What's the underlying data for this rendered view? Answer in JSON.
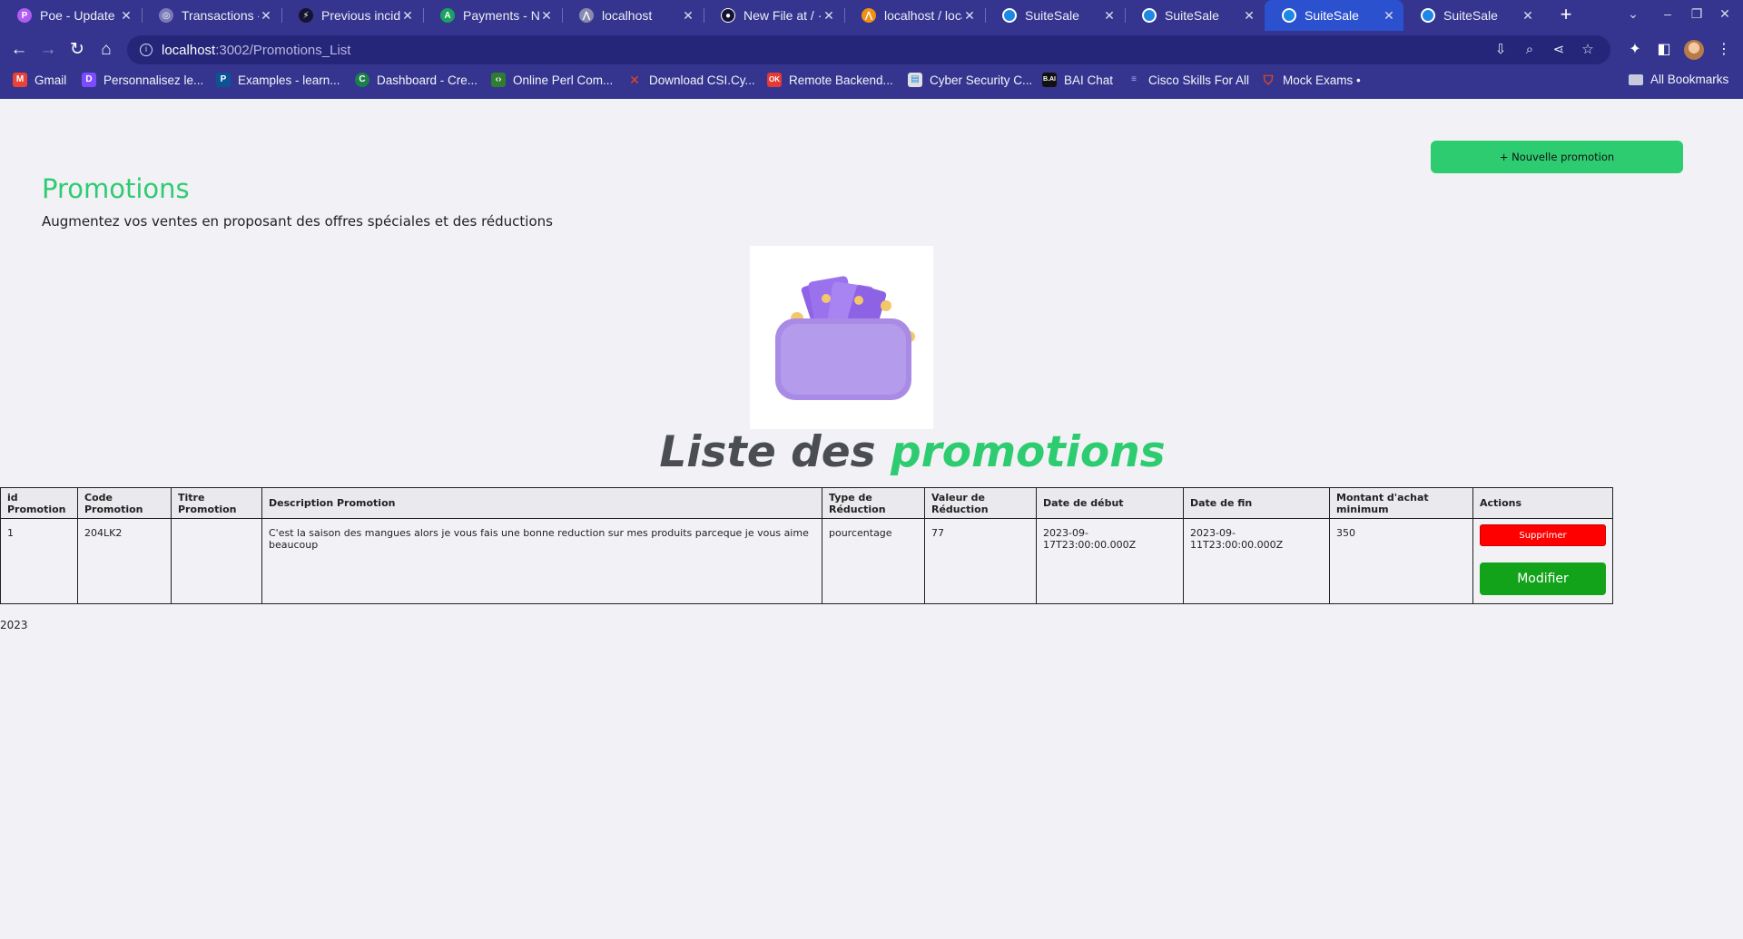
{
  "browser": {
    "tabs": [
      {
        "title": "Poe - Update C",
        "icon": "poe-icon",
        "color": "#b05cf0",
        "glyph": "P"
      },
      {
        "title": "Transactions -",
        "icon": "globe-icon",
        "color": "#7a7ab8",
        "glyph": "◎"
      },
      {
        "title": "Previous incide",
        "icon": "bolt-icon",
        "color": "#141432",
        "glyph": "⚡"
      },
      {
        "title": "Payments - No",
        "icon": "payments-icon",
        "color": "#1aa260",
        "glyph": "A"
      },
      {
        "title": "localhost",
        "icon": "xampp-icon",
        "color": "#8a8ab0",
        "glyph": "⋀"
      },
      {
        "title": "New File at / · S",
        "icon": "github-icon",
        "color": "#141432",
        "glyph": "●"
      },
      {
        "title": "localhost / loca",
        "icon": "phpmyadmin-icon",
        "color": "#f29111",
        "glyph": "⋀"
      },
      {
        "title": "SuiteSale",
        "icon": "suitesale-icon",
        "color": "#1e88e5",
        "glyph": "●"
      },
      {
        "title": "SuiteSale",
        "icon": "suitesale-icon",
        "color": "#1e88e5",
        "glyph": "●"
      },
      {
        "title": "SuiteSale",
        "icon": "suitesale-icon",
        "color": "#1e88e5",
        "glyph": "●",
        "active": true
      },
      {
        "title": "SuiteSale",
        "icon": "suitesale-icon",
        "color": "#1e88e5",
        "glyph": "●"
      }
    ],
    "url_host": "localhost",
    "url_path": ":3002/Promotions_List",
    "bookmarks": [
      {
        "label": "Gmail",
        "icon": "gmail-icon",
        "color": "#ea4335",
        "glyph": "M"
      },
      {
        "label": "Personnalisez le...",
        "icon": "bookmark-d-icon",
        "color": "#7b4dff",
        "glyph": "D"
      },
      {
        "label": "Examples - learn...",
        "icon": "bookmark-p-icon",
        "color": "#0b5394",
        "glyph": "P"
      },
      {
        "label": "Dashboard - Cre...",
        "icon": "bookmark-c-icon",
        "color": "#1b7f4b",
        "glyph": "C"
      },
      {
        "label": "Online Perl Com...",
        "icon": "code-icon",
        "color": "#2e7d32",
        "glyph": "‹›"
      },
      {
        "label": "Download CSI.Cy...",
        "icon": "bookmark-x-icon",
        "color": "#e64a19",
        "glyph": "✕"
      },
      {
        "label": "Remote Backend...",
        "icon": "bookmark-ok-icon",
        "color": "#e53935",
        "glyph": "OK"
      },
      {
        "label": "Cyber Security C...",
        "icon": "bookmark-doc-icon",
        "color": "#e0e0e0",
        "glyph": "▤"
      },
      {
        "label": "BAI Chat",
        "icon": "bai-chat-icon",
        "color": "#111111",
        "glyph": "B"
      },
      {
        "label": "Cisco Skills For All",
        "icon": "cisco-icon",
        "color": "#5e6a9e",
        "glyph": "≡"
      },
      {
        "label": "Mock Exams •",
        "icon": "shield-icon",
        "color": "#e64a19",
        "glyph": "◆"
      }
    ],
    "all_bookmarks": "All Bookmarks"
  },
  "header": {
    "new_button": "+ Nouvelle promotion",
    "title": "Promotions",
    "subtitle": "Augmentez vos ventes en proposant des offres spéciales et des réductions"
  },
  "list": {
    "title_part1": "Liste des ",
    "title_part2": "promotions",
    "columns": [
      "id Promotion",
      "Code Promotion",
      "Titre Promotion",
      "Description Promotion",
      "Type de Réduction",
      "Valeur de Réduction",
      "Date de début",
      "Date de fin",
      "Montant d'achat minimum",
      "Actions"
    ],
    "rows": [
      {
        "id": "1",
        "code": "204LK2",
        "titre": "",
        "description": "C'est la saison des mangues alors je vous fais une bonne reduction sur mes produits parceque je vous aime beaucoup",
        "type": "pourcentage",
        "valeur": "77",
        "date_debut": "2023-09-17T23:00:00.000Z",
        "date_fin": "2023-09-11T23:00:00.000Z",
        "montant_min": "350",
        "delete_label": "Supprimer",
        "edit_label": "Modifier"
      }
    ]
  },
  "footer": {
    "year": "2023"
  },
  "colors": {
    "accent_green": "#2ecc71",
    "delete_red": "#ff0000",
    "edit_green": "#13a31b",
    "chrome_blue": "#35358f"
  }
}
